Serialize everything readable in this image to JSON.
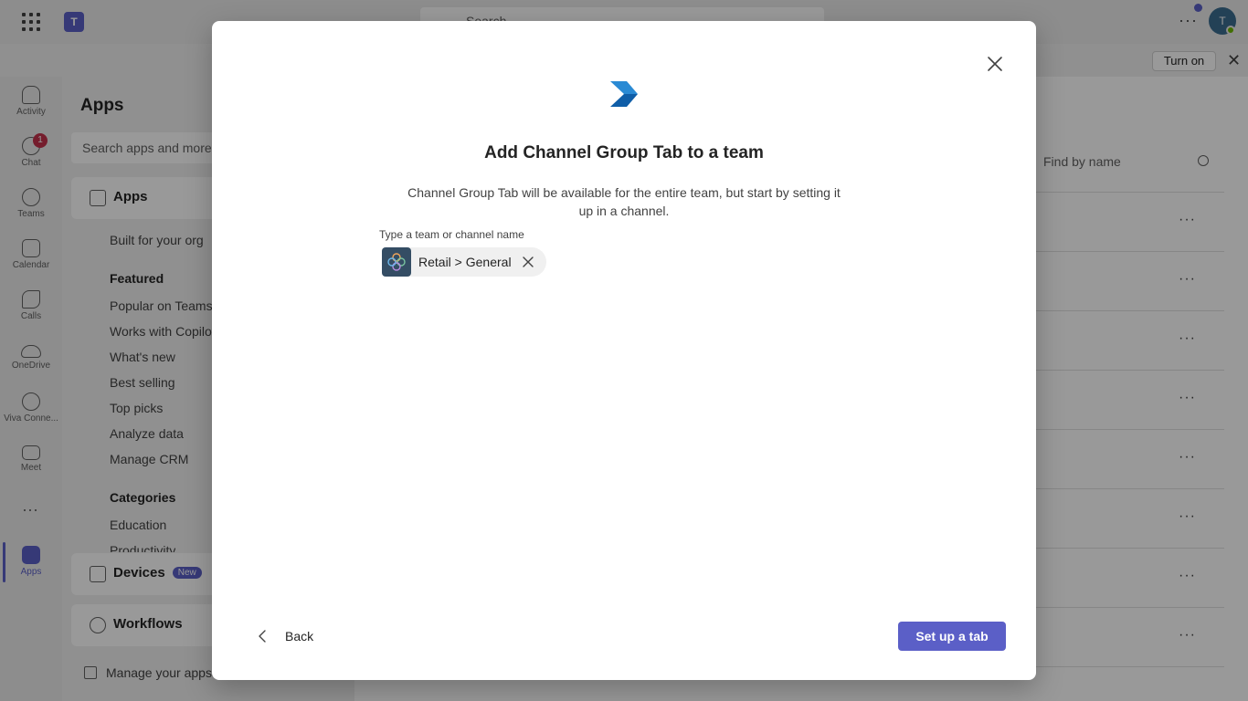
{
  "topbar": {
    "search_placeholder": "Search",
    "teams_logo_text": "T",
    "avatar_initial": "T",
    "more_label": "···"
  },
  "notification_bar": {
    "turn_on_label": "Turn on"
  },
  "rail": {
    "items": [
      {
        "label": "Activity",
        "icon": "bell-icon"
      },
      {
        "label": "Chat",
        "icon": "chat-icon",
        "badge": "1"
      },
      {
        "label": "Teams",
        "icon": "teams-icon"
      },
      {
        "label": "Calendar",
        "icon": "calendar-icon"
      },
      {
        "label": "Calls",
        "icon": "phone-icon"
      },
      {
        "label": "OneDrive",
        "icon": "cloud-icon"
      },
      {
        "label": "Viva Conne...",
        "icon": "viva-icon"
      },
      {
        "label": "Meet",
        "icon": "video-icon"
      },
      {
        "label": "Apps",
        "icon": "apps-icon",
        "active": true
      }
    ],
    "more_label": "···"
  },
  "apps_panel": {
    "title": "Apps",
    "search_placeholder": "Search apps and more",
    "apps_section": "Apps",
    "built_for_org": "Built for your org",
    "featured_heading": "Featured",
    "featured_items": [
      "Popular on Teams",
      "Works with Copilot",
      "What's new",
      "Best selling",
      "Top picks",
      "Analyze data",
      "Manage CRM"
    ],
    "categories_heading": "Categories",
    "category_items": [
      "Education",
      "Productivity"
    ],
    "devices_section": "Devices",
    "devices_badge": "New",
    "workflows_section": "Workflows",
    "manage_apps": "Manage your apps"
  },
  "content": {
    "find_placeholder": "Find by name",
    "row_more_label": "···"
  },
  "dialog": {
    "title": "Add Channel Group Tab to a team",
    "description": "Channel Group Tab will be available for the entire team, but start by setting it up in a channel.",
    "field_label": "Type a team or channel name",
    "selected_chip": "Retail > General",
    "back_label": "Back",
    "primary_button": "Set up a tab"
  },
  "colors": {
    "accent": "#5b5fc7",
    "overlay": "rgba(0,0,0,0.40)",
    "chip_background": "#f0f0f0",
    "logo_light": "#2a8ad4",
    "logo_dark": "#0f5ea8"
  }
}
